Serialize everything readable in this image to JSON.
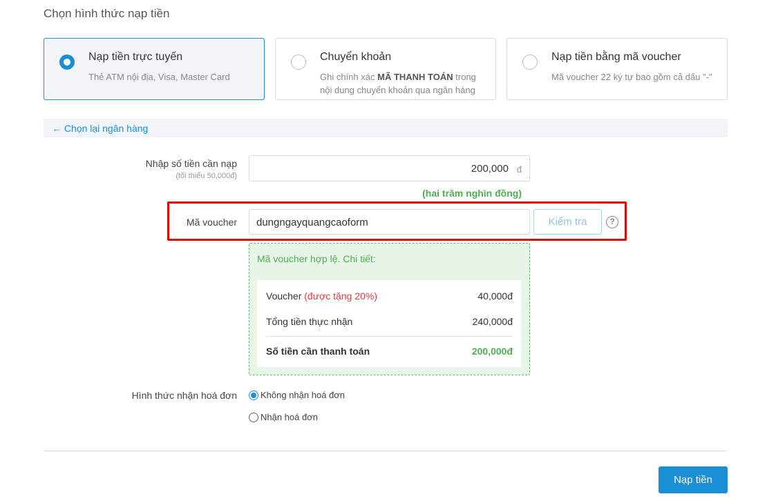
{
  "section_title": "Chọn hình thức nạp tiền",
  "methods": [
    {
      "title": "Nạp tiền trực tuyến",
      "desc": "Thẻ ATM nội địa, Visa, Master Card",
      "selected": true
    },
    {
      "title": "Chuyển khoản",
      "desc_pre": "Ghi chính xác ",
      "desc_bold": "MÃ THANH TOÁN",
      "desc_post": " trong nội dung chuyển khoản qua ngân hàng",
      "selected": false
    },
    {
      "title": "Nạp tiền bằng mã voucher",
      "desc": "Mã voucher 22 ký tự bao gồm cả dấu \"-\"",
      "selected": false
    }
  ],
  "back_link": "← Chọn lại ngân hàng",
  "amount": {
    "label": "Nhập số tiền cần nạp",
    "sublabel": "(tối thiểu 50,000đ)",
    "value": "200,000",
    "unit": "đ",
    "in_words": "(hai trăm nghìn đồng)"
  },
  "voucher": {
    "label": "Mã voucher",
    "value": "dungngayquangcaoform",
    "check_button": "Kiểm tra",
    "help_icon": "?"
  },
  "result": {
    "title": "Mã voucher hợp lệ. Chi tiết:",
    "voucher_label": "Voucher ",
    "voucher_bonus": "(được tặng 20%)",
    "voucher_value": "40,000đ",
    "total_received_label": "Tổng tiền thực nhận",
    "total_received_value": "240,000đ",
    "to_pay_label": "Số tiền cần thanh toán",
    "to_pay_value": "200,000đ"
  },
  "invoice": {
    "label": "Hình thức nhận hoá đơn",
    "options": [
      {
        "label": "Không nhận hoá đơn",
        "checked": true
      },
      {
        "label": "Nhận hoá đơn",
        "checked": false
      }
    ]
  },
  "submit_button": "Nạp tiền",
  "colors": {
    "accent": "#1a8fd6",
    "success": "#4caf50",
    "highlight": "#e60000",
    "bonus": "#e53935"
  }
}
